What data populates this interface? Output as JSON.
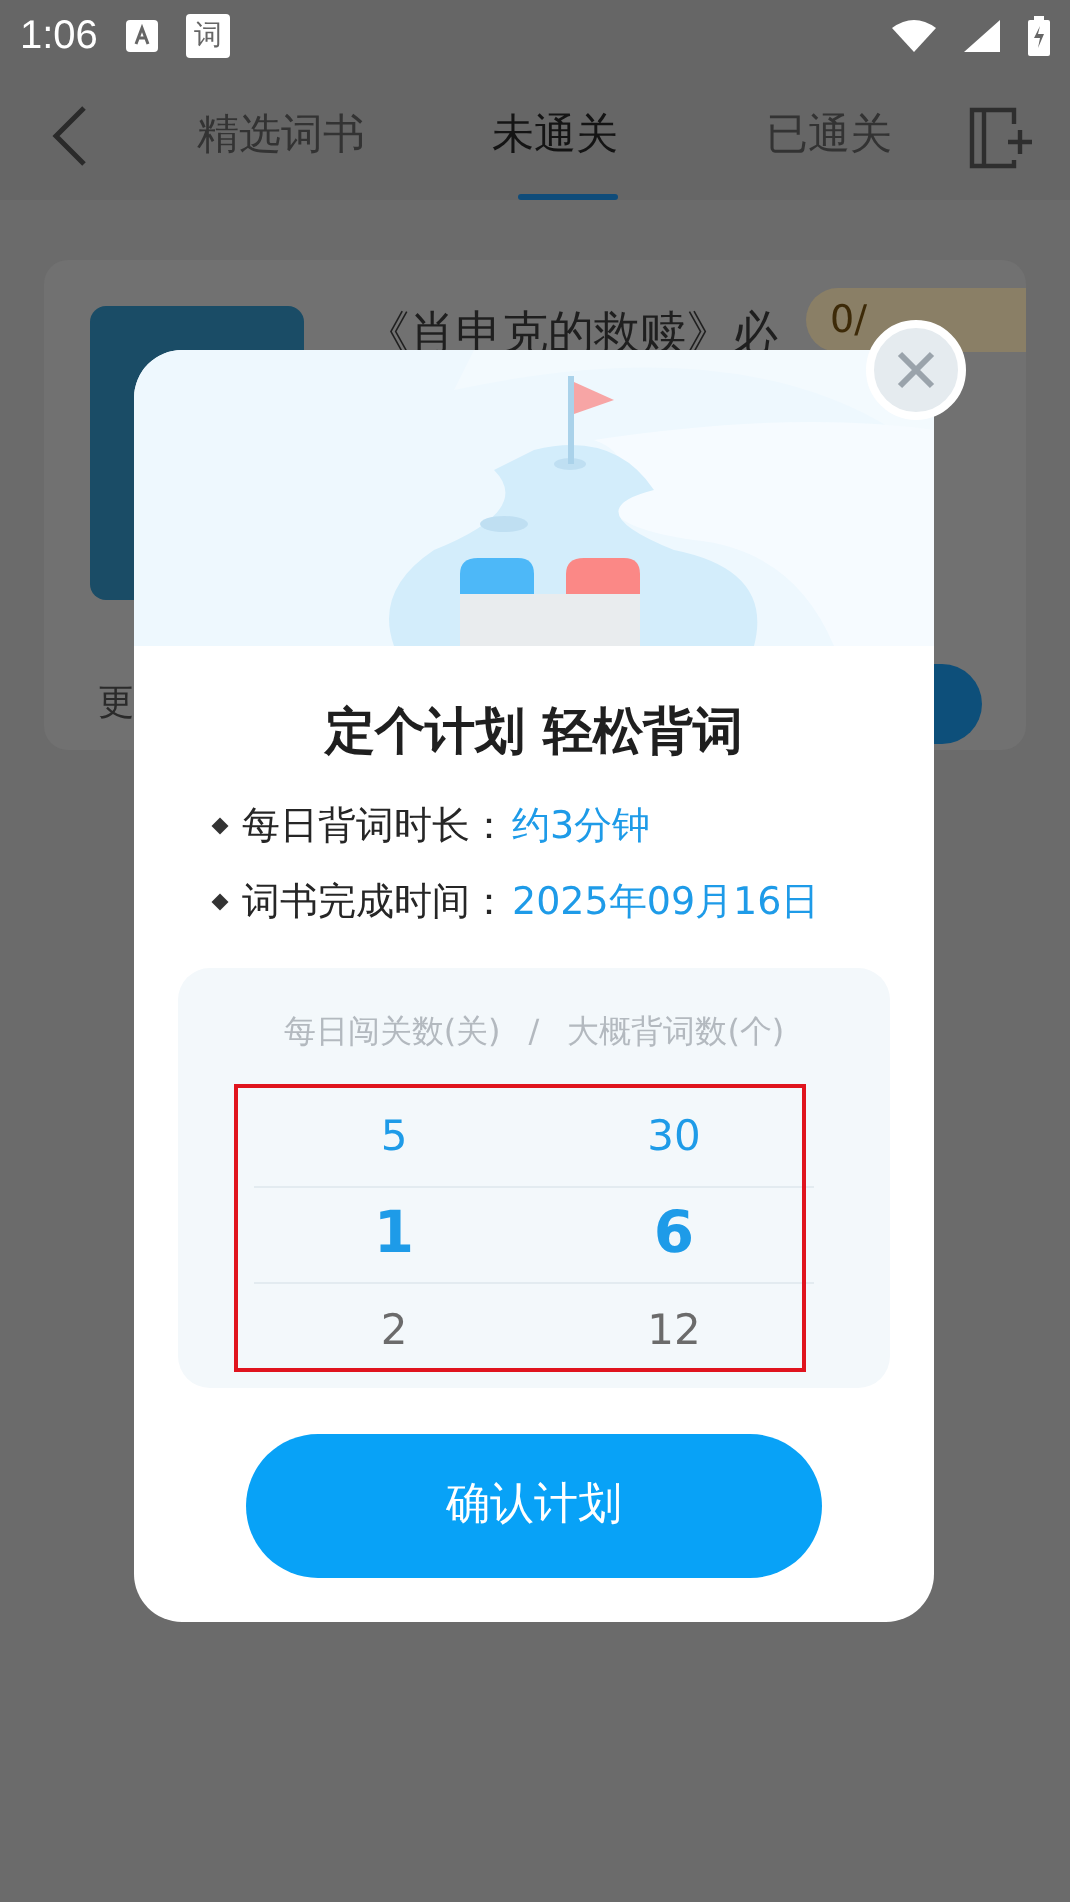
{
  "status_bar": {
    "time": "1:06",
    "app_icons": [
      {
        "kind": "translate"
      },
      {
        "kind": "text",
        "label": "词"
      }
    ]
  },
  "tabs": [
    {
      "label": "精选词书",
      "selected": false
    },
    {
      "label": "未通关",
      "selected": true
    },
    {
      "label": "已通关",
      "selected": false
    }
  ],
  "book_card": {
    "title": "《肖申克的救赎》必",
    "badge": "0/",
    "footer": "更"
  },
  "dialog": {
    "title": "定个计划 轻松背词",
    "info": [
      {
        "label": "每日背词时长：",
        "value": "约3分钟"
      },
      {
        "label": "词书完成时间：",
        "value": "2025年09月16日"
      }
    ],
    "picker": {
      "header_left": "每日闯关数(关)",
      "separator": "/",
      "header_right": "大概背词数(个)",
      "highlighted": true,
      "rows": [
        {
          "levels": "5",
          "words": "30",
          "selected": false,
          "color": "#1e9be8"
        },
        {
          "levels": "1",
          "words": "6",
          "selected": true,
          "color": "#1e9be8"
        },
        {
          "levels": "2",
          "words": "12",
          "selected": false,
          "color": "#6b6b6b"
        }
      ]
    },
    "confirm_button": "确认计划"
  }
}
